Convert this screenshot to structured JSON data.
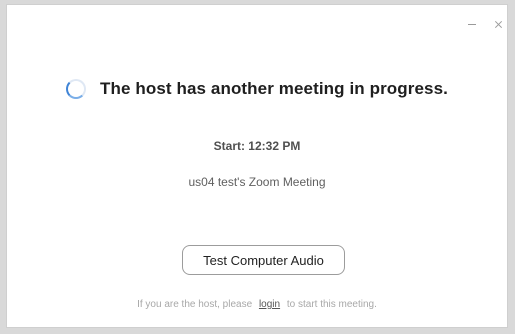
{
  "window": {
    "minimize_icon": "minimize-icon",
    "close_icon": "close-icon"
  },
  "status": {
    "spinner_icon": "loading-spinner-icon",
    "headline": "The host has another meeting in progress.",
    "start_time": "Start: 12:32 PM",
    "meeting_name": "us04 test's Zoom Meeting"
  },
  "actions": {
    "test_audio_label": "Test Computer Audio"
  },
  "footer": {
    "prefix": "If you are the host, please",
    "login_label": "login",
    "suffix": "to start this meeting."
  },
  "colors": {
    "accent": "#3f84d6",
    "headline": "#1f1f1f",
    "muted": "#a8a8a8"
  }
}
